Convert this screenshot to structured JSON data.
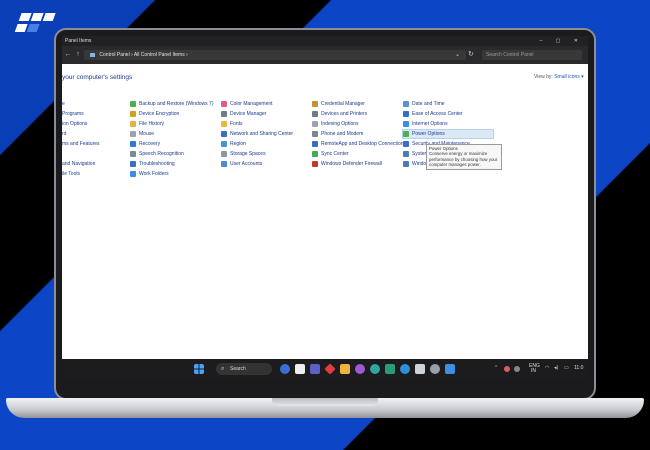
{
  "window": {
    "title": "Control Panel\\All Control Panel Items",
    "title_short": "Panel Items",
    "breadcrumb": [
      "Control Panel",
      "All Control Panel Items"
    ],
    "search_placeholder": "Search Control Panel",
    "heading": "your computer's settings",
    "view_by_label": "View by:",
    "view_by_value": "Small icons"
  },
  "columns": [
    [
      "e",
      "Programs",
      "ion Options",
      "rd",
      "ms and Features",
      "",
      "and Navigation",
      "ile Tools"
    ],
    [
      "Backup and Restore (Windows 7)",
      "Device Encryption",
      "File History",
      "Mouse",
      "Recovery",
      "Speech Recognition",
      "Troubleshooting",
      "Work Folders"
    ],
    [
      "Color Management",
      "Device Manager",
      "Fonts",
      "Network and Sharing Center",
      "Region",
      "Storage Spaces",
      "User Accounts"
    ],
    [
      "Credential Manager",
      "Devices and Printers",
      "Indexing Options",
      "Phone and Modem",
      "RemoteApp and Desktop Connections",
      "Sync Center",
      "Windows Defender Firewall"
    ],
    [
      "Date and Time",
      "Ease of Access Center",
      "Internet Options",
      "Power Options",
      "Security and Maintenance",
      "System",
      "Windo"
    ]
  ],
  "tooltip": {
    "title": "Power Options",
    "text": "Conserve energy or maximize performance by choosing how your computer manages power."
  },
  "taskbar": {
    "search_label": "Search",
    "lang_top": "ENG",
    "lang_bottom": "IN",
    "clock": "11:0"
  },
  "colors": {
    "screen_bg": "#ffffff",
    "link": "#1a3a8f",
    "taskbar": "#1c1c1e",
    "brand_blue": "#0c46c7"
  }
}
